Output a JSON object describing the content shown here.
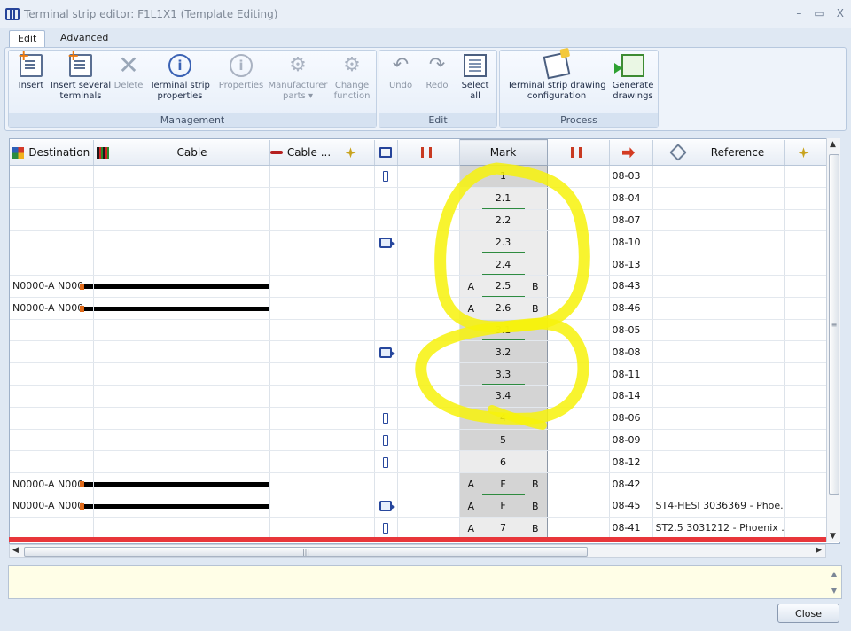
{
  "window": {
    "title": "Terminal strip editor: F1L1X1 (Template Editing)",
    "minimize": "–",
    "restore": "▭",
    "close": "X"
  },
  "tabs": [
    {
      "label": "Edit"
    },
    {
      "label": "Advanced"
    }
  ],
  "ribbon": {
    "management": {
      "label": "Management",
      "buttons": [
        {
          "label": "Insert"
        },
        {
          "label": "Insert several terminals"
        },
        {
          "label": "Delete"
        },
        {
          "label": "Terminal strip properties"
        },
        {
          "label": "Properties"
        },
        {
          "label": "Manufacturer parts",
          "suffix": "▾"
        },
        {
          "label": "Change function"
        }
      ]
    },
    "edit": {
      "label": "Edit",
      "buttons": [
        {
          "label": "Undo"
        },
        {
          "label": "Redo"
        },
        {
          "label": "Select all"
        }
      ]
    },
    "process": {
      "label": "Process",
      "buttons": [
        {
          "label": "Terminal strip drawing configuration"
        },
        {
          "label": "Generate drawings"
        }
      ]
    }
  },
  "columns": {
    "destination": "Destination",
    "cable": "Cable",
    "cable2": "Cable ...",
    "mark": "Mark",
    "reference": "Reference"
  },
  "rows": [
    {
      "dest": "",
      "cable": false,
      "icon": "single",
      "mark": "1",
      "mark_style": "dark",
      "a": "",
      "b": "",
      "ul": false,
      "cp": "08-03",
      "ref": ""
    },
    {
      "dest": "",
      "cable": false,
      "icon": "",
      "mark": "2.1",
      "mark_style": "light",
      "a": "",
      "b": "",
      "ul": true,
      "cp": "08-04",
      "ref": ""
    },
    {
      "dest": "",
      "cable": false,
      "icon": "",
      "mark": "2.2",
      "mark_style": "light",
      "a": "",
      "b": "",
      "ul": true,
      "cp": "08-07",
      "ref": ""
    },
    {
      "dest": "",
      "cable": false,
      "icon": "multi",
      "mark": "2.3",
      "mark_style": "light",
      "a": "",
      "b": "",
      "ul": true,
      "cp": "08-10",
      "ref": ""
    },
    {
      "dest": "",
      "cable": false,
      "icon": "",
      "mark": "2.4",
      "mark_style": "light",
      "a": "",
      "b": "",
      "ul": true,
      "cp": "08-13",
      "ref": ""
    },
    {
      "dest": "N0000-A N000",
      "cable": true,
      "icon": "",
      "mark": "2.5",
      "mark_style": "light",
      "a": "A",
      "b": "B",
      "ul": true,
      "cp": "08-43",
      "ref": ""
    },
    {
      "dest": "N0000-A N000",
      "cable": true,
      "icon": "",
      "mark": "2.6",
      "mark_style": "light",
      "a": "A",
      "b": "B",
      "ul": false,
      "cp": "08-46",
      "ref": ""
    },
    {
      "dest": "",
      "cable": false,
      "icon": "",
      "mark": "3.1",
      "mark_style": "dark",
      "a": "",
      "b": "",
      "ul": true,
      "cp": "08-05",
      "ref": ""
    },
    {
      "dest": "",
      "cable": false,
      "icon": "multi",
      "mark": "3.2",
      "mark_style": "dark",
      "a": "",
      "b": "",
      "ul": true,
      "cp": "08-08",
      "ref": ""
    },
    {
      "dest": "",
      "cable": false,
      "icon": "",
      "mark": "3.3",
      "mark_style": "dark",
      "a": "",
      "b": "",
      "ul": true,
      "cp": "08-11",
      "ref": ""
    },
    {
      "dest": "",
      "cable": false,
      "icon": "",
      "mark": "3.4",
      "mark_style": "dark",
      "a": "",
      "b": "",
      "ul": false,
      "cp": "08-14",
      "ref": ""
    },
    {
      "dest": "",
      "cable": false,
      "icon": "single",
      "mark": "4",
      "mark_style": "dark",
      "a": "",
      "b": "",
      "ul": false,
      "cp": "08-06",
      "ref": ""
    },
    {
      "dest": "",
      "cable": false,
      "icon": "single",
      "mark": "5",
      "mark_style": "dark",
      "a": "",
      "b": "",
      "ul": false,
      "cp": "08-09",
      "ref": ""
    },
    {
      "dest": "",
      "cable": false,
      "icon": "single",
      "mark": "6",
      "mark_style": "light",
      "a": "",
      "b": "",
      "ul": false,
      "cp": "08-12",
      "ref": ""
    },
    {
      "dest": "N0000-A N000",
      "cable": true,
      "icon": "",
      "mark": "F",
      "mark_style": "dark",
      "a": "A",
      "b": "B",
      "ul": true,
      "cp": "08-42",
      "ref": ""
    },
    {
      "dest": "N0000-A N000",
      "cable": true,
      "icon": "multi",
      "mark": "F",
      "mark_style": "dark",
      "a": "A",
      "b": "B",
      "ul": false,
      "cp": "08-45",
      "ref": "ST4-HESI 3036369 - Phoe..."
    },
    {
      "dest": "",
      "cable": false,
      "icon": "single",
      "mark": "7",
      "mark_style": "light",
      "a": "A",
      "b": "B",
      "ul": false,
      "cp": "08-41",
      "ref": "ST2.5 3031212 - Phoenix ..."
    }
  ],
  "scroll": {
    "grip_h": "|||",
    "grip_v": "≡",
    "left": "◀",
    "right": "▶",
    "up": "▲",
    "down": "▼"
  },
  "footer": {
    "close_label": "Close"
  },
  "colors": {
    "highlight": "#f7f20a",
    "error_bar": "#e8363a",
    "accent": "#26449a"
  }
}
